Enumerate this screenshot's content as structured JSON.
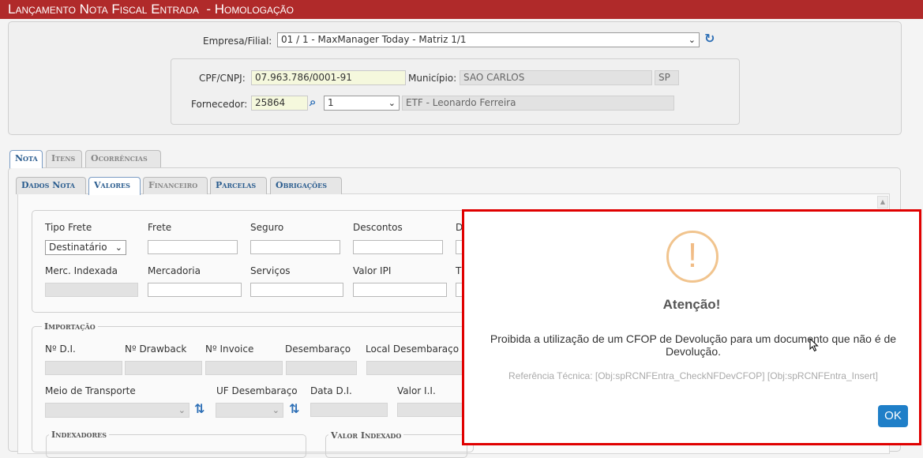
{
  "header": {
    "title": "Lançamento Nota Fiscal Entrada  - Homologação"
  },
  "empresa": {
    "label": "Empresa/Filial:",
    "value": "01 / 1 - MaxManager Today - Matriz 1/1"
  },
  "fornecedor_box": {
    "cpf_label": "CPF/CNPJ:",
    "cpf_value": "07.963.786/0001-91",
    "municipio_label": "Município:",
    "municipio_value": "SAO CARLOS",
    "uf_value": "SP",
    "fornecedor_label": "Fornecedor:",
    "fornecedor_code": "25864",
    "fornecedor_seq": "1",
    "fornecedor_name": "ETF - Leonardo Ferreira"
  },
  "main_tabs": [
    "Nota",
    "Itens",
    "Ocorrências"
  ],
  "sub_tabs": [
    "Dados Nota",
    "Valores",
    "Financeiro",
    "Parcelas",
    "Obrigações"
  ],
  "valores": {
    "tipo_frete_label": "Tipo Frete",
    "tipo_frete_value": "Destinatário",
    "frete_label": "Frete",
    "seguro_label": "Seguro",
    "descontos_label": "Descontos",
    "d_label": "D",
    "merc_indexada_label": "Merc. Indexada",
    "mercadoria_label": "Mercadoria",
    "servicos_label": "Serviços",
    "valor_ipi_label": "Valor IPI",
    "t_label": "T"
  },
  "importacao": {
    "legend": "Importação",
    "di_label": "Nº D.I.",
    "drawback_label": "Nº Drawback",
    "invoice_label": "Nº Invoice",
    "desembaraco_label": "Desembaraço",
    "local_desembaraco_label": "Local Desembaraço",
    "meio_transporte_label": "Meio de Transporte",
    "uf_desembaraco_label": "UF Desembaraço",
    "data_di_label": "Data D.I.",
    "valor_ii_label": "Valor I.I."
  },
  "indexadores": {
    "legend": "Indexadores"
  },
  "valor_indexado": {
    "legend": "Valor Indexado"
  },
  "modal": {
    "title": "Atenção!",
    "message": "Proibida a utilização de um CFOP de Devolução para um documento que não é de Devolução.",
    "reference": "Referência Técnica: [Obj:spRCNFEntra_CheckNFDevCFOP] [Obj:spRCNFEntra_Insert]",
    "ok_label": "OK"
  },
  "colors": {
    "title_bar": "#b02a2a",
    "accent_blue": "#1f7fc8",
    "warning": "#f1c48e",
    "highlight_border": "#e00000"
  }
}
